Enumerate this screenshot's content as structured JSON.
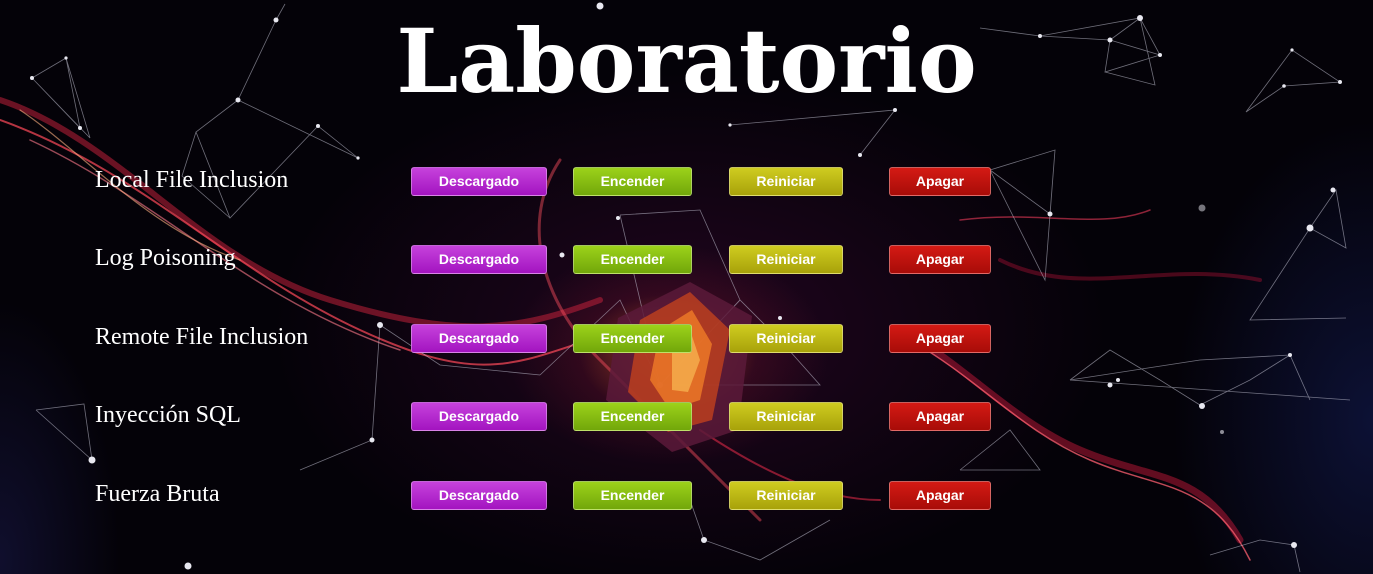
{
  "page": {
    "title": "Laboratorio"
  },
  "colors": {
    "download": "#b52acf",
    "on": "#84bb12",
    "restart": "#bcb714",
    "off": "#c0130e"
  },
  "labs": [
    {
      "name": "Local File Inclusion",
      "download_label": "Descargado",
      "on_label": "Encender",
      "restart_label": "Reiniciar",
      "off_label": "Apagar"
    },
    {
      "name": "Log Poisoning",
      "download_label": "Descargado",
      "on_label": "Encender",
      "restart_label": "Reiniciar",
      "off_label": "Apagar"
    },
    {
      "name": "Remote File Inclusion",
      "download_label": "Descargado",
      "on_label": "Encender",
      "restart_label": "Reiniciar",
      "off_label": "Apagar"
    },
    {
      "name": "Inyección SQL",
      "download_label": "Descargado",
      "on_label": "Encender",
      "restart_label": "Reiniciar",
      "off_label": "Apagar"
    },
    {
      "name": "Fuerza Bruta",
      "download_label": "Descargado",
      "on_label": "Encender",
      "restart_label": "Reiniciar",
      "off_label": "Apagar"
    }
  ]
}
